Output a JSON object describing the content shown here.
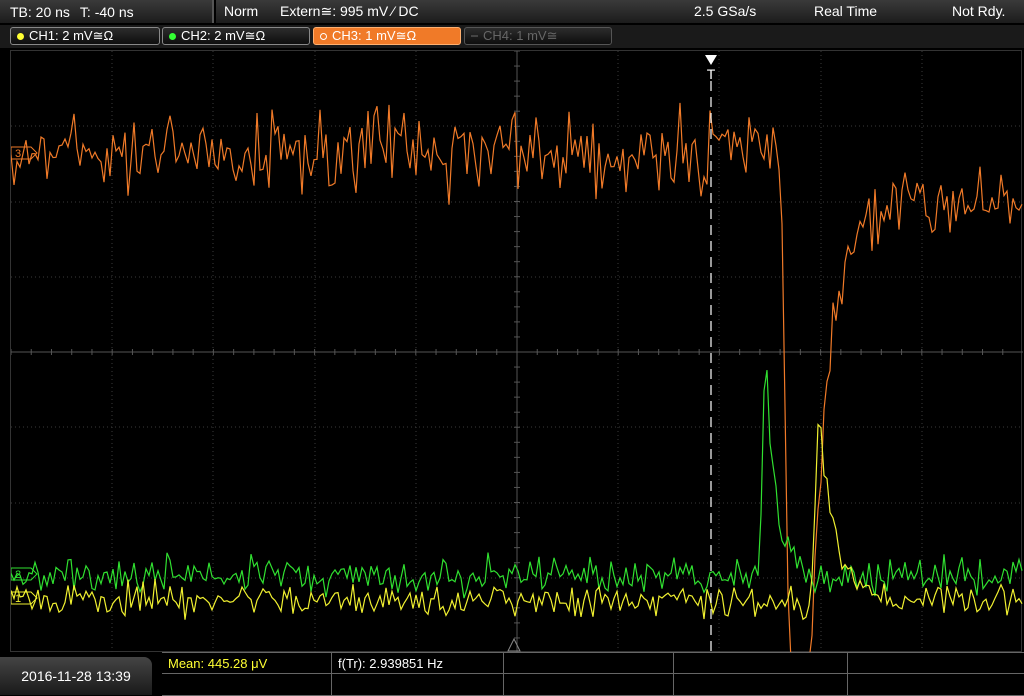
{
  "status": {
    "timebase": "TB: 20 ns",
    "trigger_time": "T: -40 ns",
    "mode": "Norm",
    "trigger_source": "Extern≅: 995 mV ⁄ DC",
    "sample_rate": "2.5 GSa/s",
    "acq_mode": "Real Time",
    "state": "Not Rdy."
  },
  "channels": [
    {
      "label": "CH1: 2 mV≅Ω",
      "color": "#ffff33",
      "active": false,
      "enabled": true
    },
    {
      "label": "CH2: 2 mV≅Ω",
      "color": "#33ff33",
      "active": false,
      "enabled": true
    },
    {
      "label": "CH3: 1 mV≅Ω",
      "color": "#f07a28",
      "active": true,
      "enabled": true
    },
    {
      "label": "CH4: 1 mV≅",
      "color": "#666666",
      "active": false,
      "enabled": false
    }
  ],
  "markers": {
    "trigger_marker": "T",
    "ch3_marker": "3",
    "ch2_marker": "2",
    "ch1_marker": "1"
  },
  "datetime": "2016-11-28 13:39",
  "measurements": {
    "mean": "Mean: 445.28 μV",
    "freq": "f(Tr): 2.939851 Hz"
  },
  "colors": {
    "ch1": "#f0f030",
    "ch2": "#30e030",
    "ch3": "#f07a28",
    "grid": "#3a3a3a",
    "trigger": "#ffffff"
  }
}
